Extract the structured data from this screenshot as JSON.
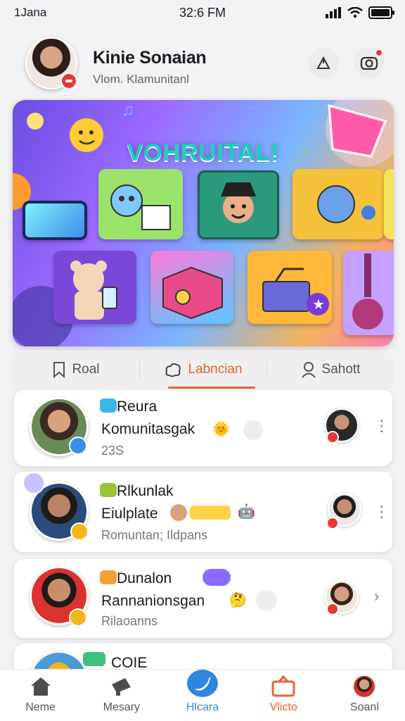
{
  "status": {
    "left": "1Jana",
    "time": "32:6 FM"
  },
  "profile": {
    "name": "Kinie Sonaian",
    "subtitle": "Vlom. Klamunitanl"
  },
  "banner": {
    "title": "VOHRUITAL!"
  },
  "tabs": [
    {
      "label": "Roal",
      "icon": "bookmark-icon"
    },
    {
      "label": "Labncian",
      "icon": "community-icon",
      "active": true
    },
    {
      "label": "Sahott",
      "icon": "person-icon"
    }
  ],
  "feed": [
    {
      "title": "Reura",
      "line": "Komunitasgak",
      "meta": "23S",
      "tag_color": "#3ab6e8",
      "badge_color": "#3b8ee8"
    },
    {
      "title": "Rlkunlak",
      "line": "Eiulplate",
      "meta": "Romuntan; Ildpans",
      "tag_color": "#9ac43a",
      "badge_color": "#f2b61c"
    },
    {
      "title": "Dunalon",
      "line": "Rannanionsgan",
      "meta": "Rilaoanns",
      "tag_color": "#f2a13a",
      "badge_color": "#f2b61c"
    },
    {
      "title": "COIE",
      "tag_color": "#3fbf7f"
    }
  ],
  "nav": [
    {
      "label": "Neme",
      "icon": "home-icon"
    },
    {
      "label": "Mesary",
      "icon": "megaphone-icon"
    },
    {
      "label": "Hlcara",
      "icon": "bird-icon"
    },
    {
      "label": "Vlicto",
      "icon": "video-icon"
    },
    {
      "label": "Soanl",
      "icon": "profile-avatar-icon"
    }
  ]
}
